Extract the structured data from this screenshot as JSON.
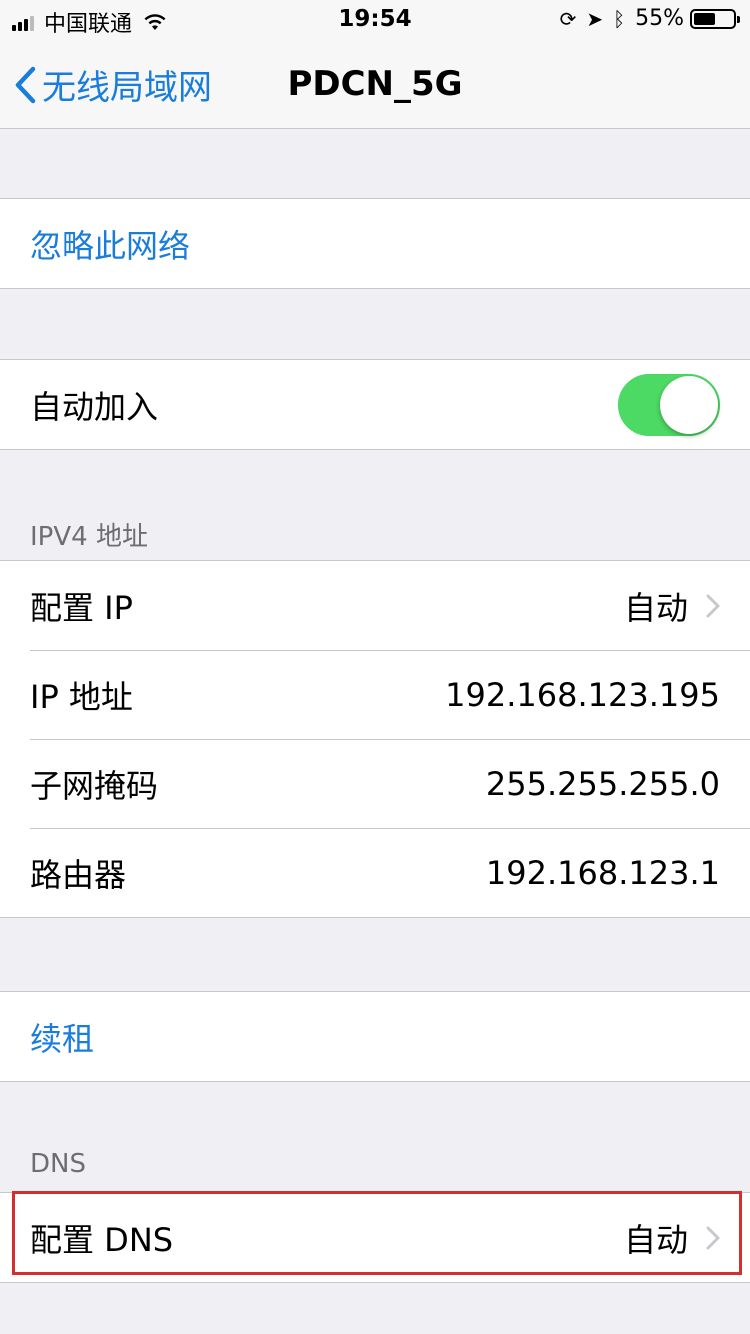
{
  "status_bar": {
    "carrier": "中国联通",
    "time": "19:54",
    "battery_percent_label": "55%",
    "battery_level": 0.55
  },
  "nav": {
    "back_label": "无线局域网",
    "title": "PDCN_5G"
  },
  "forget": {
    "label": "忽略此网络"
  },
  "auto_join": {
    "label": "自动加入",
    "on": true
  },
  "ipv4": {
    "header": "IPV4 地址",
    "rows": [
      {
        "label": "配置 IP",
        "value": "自动",
        "chevron": true
      },
      {
        "label": "IP 地址",
        "value": "192.168.123.195"
      },
      {
        "label": "子网掩码",
        "value": "255.255.255.0"
      },
      {
        "label": "路由器",
        "value": "192.168.123.1"
      }
    ]
  },
  "renew": {
    "label": "续租"
  },
  "dns": {
    "header": "DNS",
    "row": {
      "label": "配置 DNS",
      "value": "自动"
    }
  },
  "colors": {
    "accent": "#1a7ddb",
    "toggle_on": "#4cd964",
    "highlight": "#d32f2f"
  }
}
